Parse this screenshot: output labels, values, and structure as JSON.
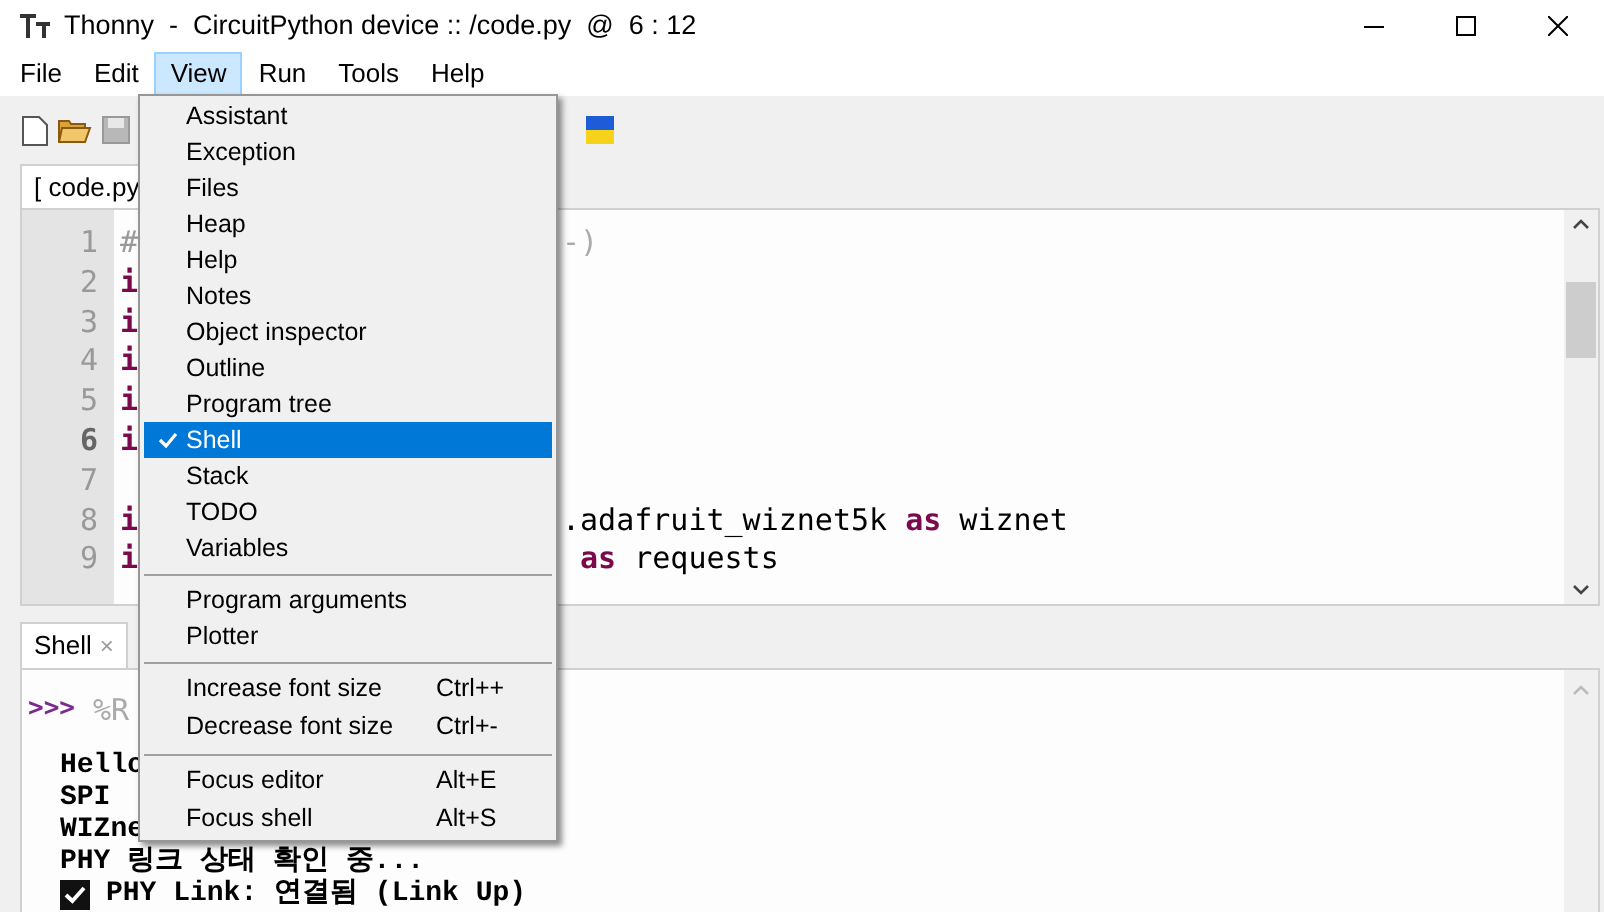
{
  "window": {
    "title": "Thonny  -  CircuitPython device :: /code.py  @  6 : 12"
  },
  "menubar": [
    {
      "label": "File",
      "selected": false
    },
    {
      "label": "Edit",
      "selected": false
    },
    {
      "label": "View",
      "selected": true
    },
    {
      "label": "Run",
      "selected": false
    },
    {
      "label": "Tools",
      "selected": false
    },
    {
      "label": "Help",
      "selected": false
    }
  ],
  "editor": {
    "tab": "[ code.py",
    "lines": [
      {
        "number": "1",
        "current": false,
        "left": "#",
        "right": "-)",
        "kind": "comment"
      },
      {
        "number": "2",
        "current": false,
        "left": "i",
        "kind": "code"
      },
      {
        "number": "3",
        "current": false,
        "left": "i",
        "kind": "code"
      },
      {
        "number": "4",
        "current": false,
        "left": "i",
        "kind": "code"
      },
      {
        "number": "5",
        "current": false,
        "left": "i",
        "kind": "code"
      },
      {
        "number": "6",
        "current": true,
        "left": "i",
        "kind": "code"
      },
      {
        "number": "7",
        "current": false
      },
      {
        "number": "8",
        "current": false,
        "left": "i",
        "right": ".adafruit_wiznet5k **as** wiznet",
        "kind": "code"
      },
      {
        "number": "9",
        "current": false,
        "left": "i",
        "right": " **as** requests",
        "kind": "code"
      }
    ]
  },
  "shell": {
    "tab": "Shell",
    "close": "×",
    "prompt": ">>>",
    "command": "%R",
    "lines": [
      {
        "text": "Hello",
        "kind": "plain"
      },
      {
        "text": "SPI",
        "kind": "plain"
      },
      {
        "text": "WIZne",
        "kind": "plain"
      },
      {
        "text": "PHY 링크 상태 확인 중...",
        "kind": "plain"
      },
      {
        "text": "PHY Link: 연결됨 (Link Up)",
        "kind": "checked"
      }
    ]
  },
  "menu": {
    "sections": [
      {
        "items": [
          {
            "label": "Assistant",
            "checked": false,
            "selected": false
          },
          {
            "label": "Exception",
            "checked": false,
            "selected": false
          },
          {
            "label": "Files",
            "checked": false,
            "selected": false
          },
          {
            "label": "Heap",
            "checked": false,
            "selected": false
          },
          {
            "label": "Help",
            "checked": false,
            "selected": false
          },
          {
            "label": "Notes",
            "checked": false,
            "selected": false
          },
          {
            "label": "Object inspector",
            "checked": false,
            "selected": false
          },
          {
            "label": "Outline",
            "checked": false,
            "selected": false
          },
          {
            "label": "Program tree",
            "checked": false,
            "selected": false
          },
          {
            "label": "Shell",
            "checked": true,
            "selected": true
          },
          {
            "label": "Stack",
            "checked": false,
            "selected": false
          },
          {
            "label": "TODO",
            "checked": false,
            "selected": false
          },
          {
            "label": "Variables",
            "checked": false,
            "selected": false
          }
        ]
      },
      {
        "items": [
          {
            "label": "Program arguments",
            "checked": false,
            "selected": false
          },
          {
            "label": "Plotter",
            "checked": false,
            "selected": false
          }
        ]
      },
      {
        "items": [
          {
            "label": "Increase font size",
            "shortcut": "Ctrl++",
            "checked": false,
            "selected": false
          },
          {
            "label": "Decrease font size",
            "shortcut": "Ctrl+-",
            "checked": false,
            "selected": false
          }
        ]
      },
      {
        "items": [
          {
            "label": "Focus editor",
            "shortcut": "Alt+E",
            "checked": false,
            "selected": false
          },
          {
            "label": "Focus shell",
            "shortcut": "Alt+S",
            "checked": false,
            "selected": false
          }
        ]
      }
    ]
  }
}
